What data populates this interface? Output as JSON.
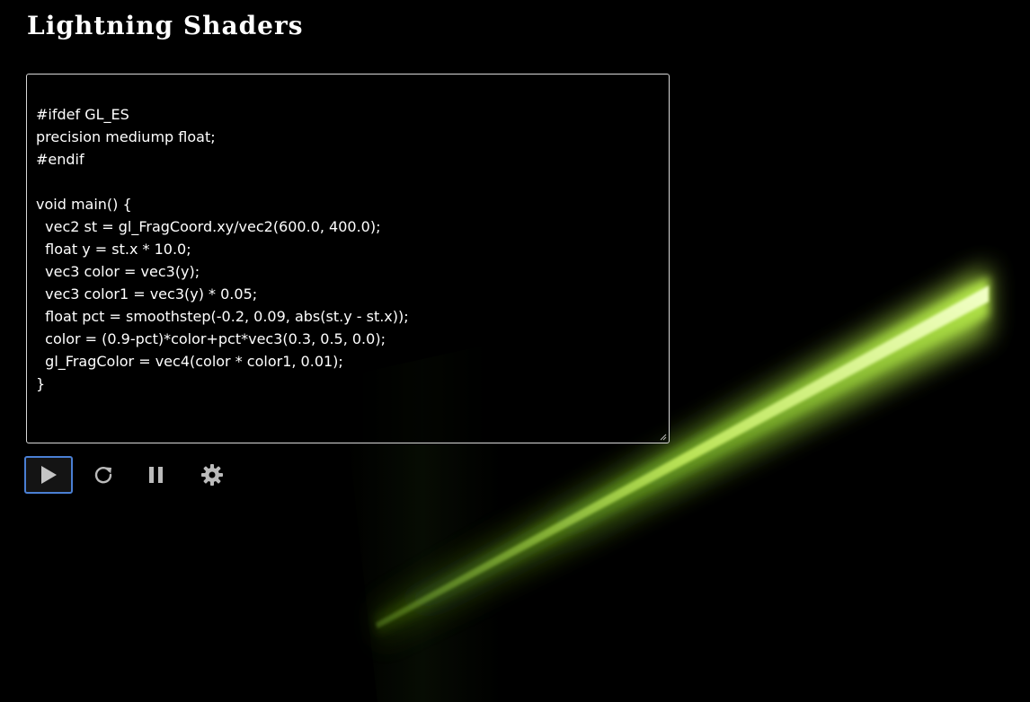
{
  "app": {
    "title": "Lightning Shaders"
  },
  "editor": {
    "code": "#ifdef GL_ES\nprecision mediump float;\n#endif\n\nvoid main() {\n  vec2 st = gl_FragCoord.xy/vec2(600.0, 400.0);\n  float y = st.x * 10.0;\n  vec3 color = vec3(y);\n  vec3 color1 = vec3(y) * 0.05;\n  float pct = smoothstep(-0.2, 0.09, abs(st.y - st.x));\n  color = (0.9-pct)*color+pct*vec3(0.3, 0.5, 0.0);\n  gl_FragColor = vec4(color * color1, 0.01);\n}"
  },
  "controls": {
    "play_icon": "play-icon",
    "reload_icon": "reload-icon",
    "pause_icon": "pause-icon",
    "settings_icon": "gear-icon"
  },
  "colors": {
    "background": "#000000",
    "text": "#ffffff",
    "beam": "#c8f060",
    "beam_glow": "#4a7a10",
    "active_border": "#4a7fd4",
    "icon": "#bbbbbb"
  }
}
